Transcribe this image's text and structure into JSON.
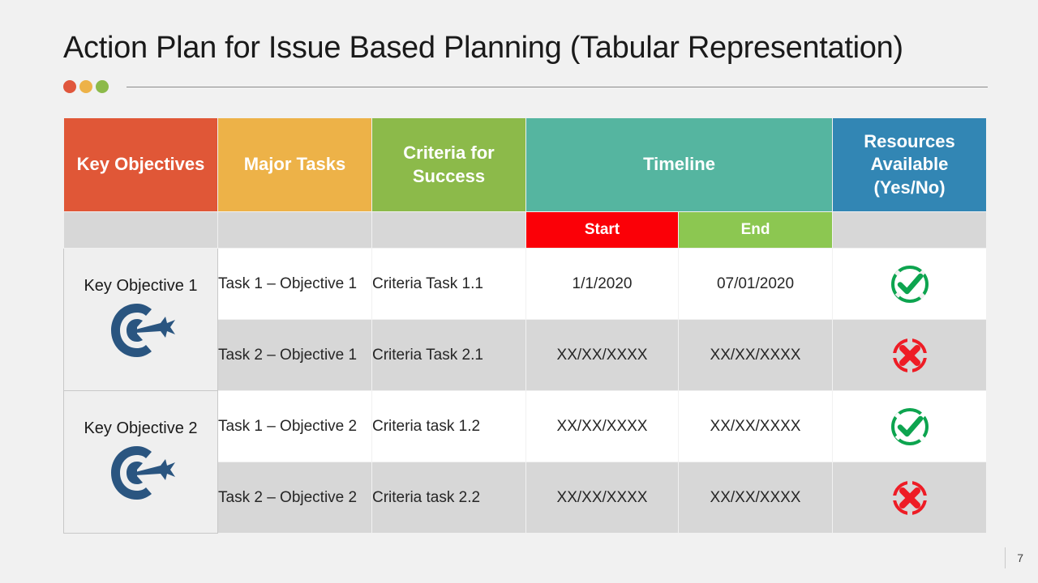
{
  "slide": {
    "title": "Action Plan for Issue Based Planning (Tabular Representation)",
    "page_number": "7",
    "background_color": "#F1F1F1",
    "accent_dots": [
      "#E0563C",
      "#EDB248",
      "#8CBA4A"
    ]
  },
  "table": {
    "headers": {
      "key_objectives": "Key Objectives",
      "major_tasks": "Major Tasks",
      "criteria_for_success": "Criteria for Success",
      "timeline": "Timeline",
      "resources_available": "Resources Available (Yes/No)"
    },
    "subheaders": {
      "start": "Start",
      "end": "End"
    },
    "header_colors": {
      "key_objectives": "#E05737",
      "major_tasks": "#EDB248",
      "criteria_for_success": "#8CBA4A",
      "timeline": "#55B5A0",
      "resources_available": "#3286B4",
      "start": "#FB0007",
      "end": "#8CC751",
      "subheader_blank": "#D7D7D7"
    },
    "objectives": [
      {
        "label": "Key Objective 1",
        "icon": "target-dart-icon",
        "rows": [
          {
            "task": "Task 1 – Objective 1",
            "criteria": "Criteria Task 1.1",
            "start": "1/1/2020",
            "end": "07/01/2020",
            "resource_status": "yes",
            "status_icon": "check-circle-icon",
            "status_color": "#0DA44F",
            "stripe": "white"
          },
          {
            "task": "Task 2 – Objective 1",
            "criteria": "Criteria Task 2.1",
            "start": "XX/XX/XXXX",
            "end": "XX/XX/XXXX",
            "resource_status": "no",
            "status_icon": "cross-circle-icon",
            "status_color": "#EE1C25",
            "stripe": "gray"
          }
        ]
      },
      {
        "label": "Key Objective 2",
        "icon": "target-dart-icon",
        "rows": [
          {
            "task": "Task 1 – Objective 2",
            "criteria": "Criteria task 1.2",
            "start": "XX/XX/XXXX",
            "end": "XX/XX/XXXX",
            "resource_status": "yes",
            "status_icon": "check-circle-icon",
            "status_color": "#0DA44F",
            "stripe": "white"
          },
          {
            "task": "Task 2 – Objective 2",
            "criteria": "Criteria task 2.2",
            "start": "XX/XX/XXXX",
            "end": "XX/XX/XXXX",
            "resource_status": "no",
            "status_icon": "cross-circle-icon",
            "status_color": "#EE1C25",
            "stripe": "gray"
          }
        ]
      }
    ]
  }
}
